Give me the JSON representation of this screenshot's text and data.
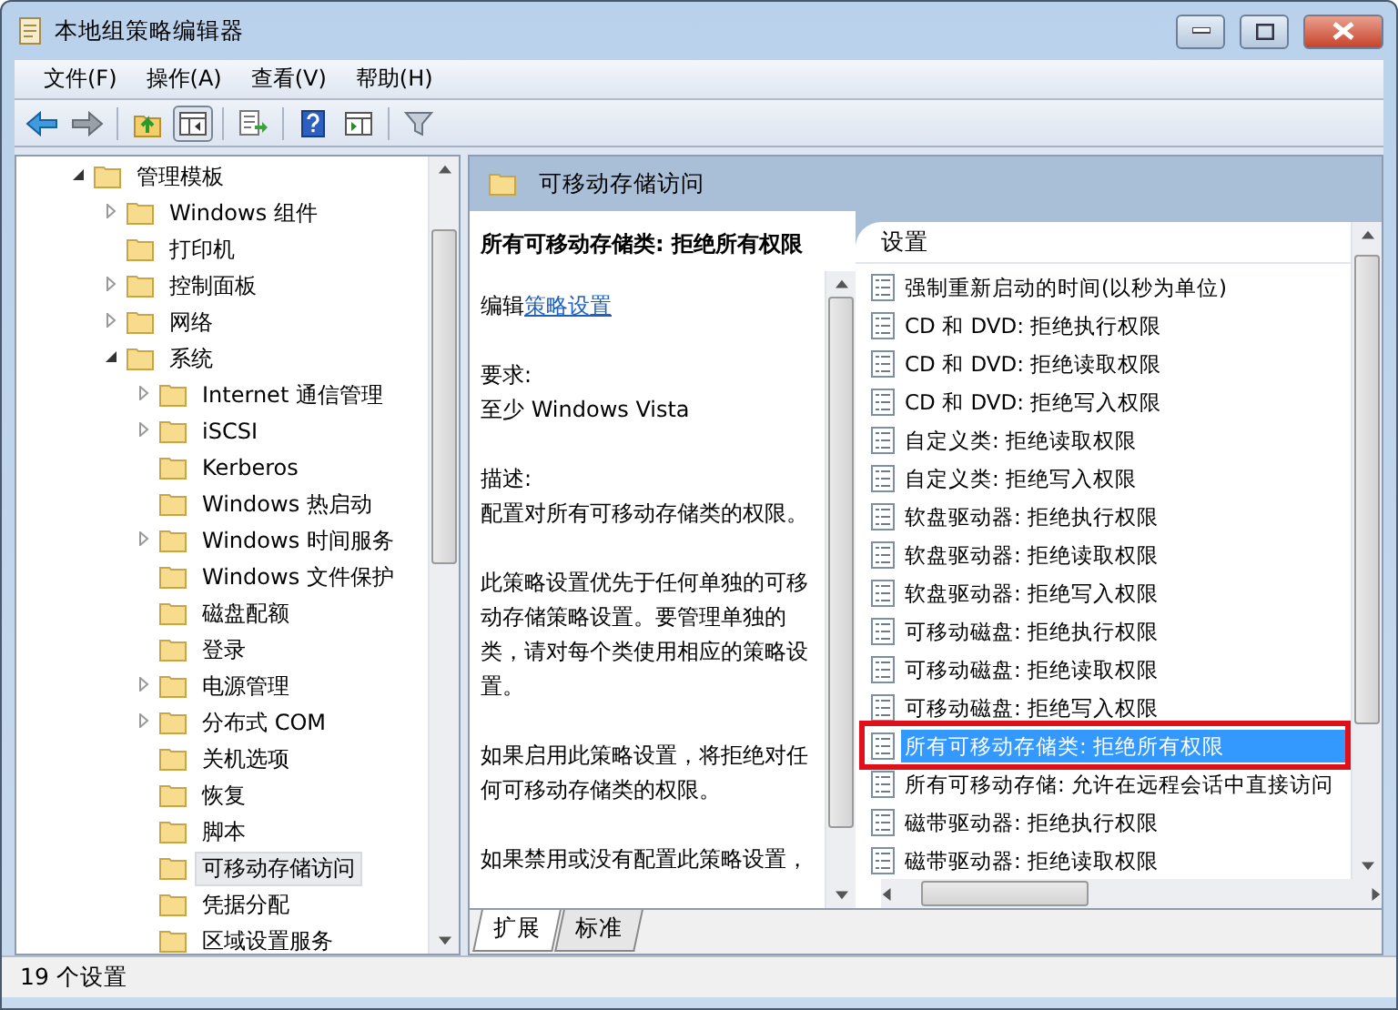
{
  "window": {
    "title": "本地组策略编辑器"
  },
  "menu": [
    {
      "label": "文件(F)"
    },
    {
      "label": "操作(A)"
    },
    {
      "label": "查看(V)"
    },
    {
      "label": "帮助(H)"
    }
  ],
  "toolbar_groups": [
    [
      {
        "kind": "back",
        "pressed": false
      },
      {
        "kind": "forward",
        "pressed": false
      }
    ],
    [
      {
        "kind": "up",
        "pressed": false
      },
      {
        "kind": "tree",
        "pressed": true
      }
    ],
    [
      {
        "kind": "export",
        "pressed": false
      }
    ],
    [
      {
        "kind": "help",
        "pressed": false
      },
      {
        "kind": "view",
        "pressed": false
      }
    ],
    [
      {
        "kind": "filter",
        "pressed": false
      }
    ]
  ],
  "tree": [
    {
      "label": "管理模板",
      "expanded": true,
      "selected": false,
      "children": [
        {
          "label": "Windows 组件",
          "expanded": false,
          "selected": false
        },
        {
          "label": "打印机",
          "selected": false
        },
        {
          "label": "控制面板",
          "expanded": false,
          "selected": false
        },
        {
          "label": "网络",
          "expanded": false,
          "selected": false
        },
        {
          "label": "系统",
          "expanded": true,
          "selected": false,
          "children": [
            {
              "label": "Internet 通信管理",
              "expanded": false,
              "selected": false
            },
            {
              "label": "iSCSI",
              "expanded": false,
              "selected": false
            },
            {
              "label": "Kerberos",
              "selected": false
            },
            {
              "label": "Windows 热启动",
              "selected": false
            },
            {
              "label": "Windows 时间服务",
              "expanded": false,
              "selected": false
            },
            {
              "label": "Windows 文件保护",
              "selected": false
            },
            {
              "label": "磁盘配额",
              "selected": false
            },
            {
              "label": "登录",
              "selected": false
            },
            {
              "label": "电源管理",
              "expanded": false,
              "selected": false
            },
            {
              "label": "分布式 COM",
              "expanded": false,
              "selected": false
            },
            {
              "label": "关机选项",
              "selected": false
            },
            {
              "label": "恢复",
              "selected": false
            },
            {
              "label": "脚本",
              "selected": false
            },
            {
              "label": "可移动存储访问",
              "selected": true
            },
            {
              "label": "凭据分配",
              "selected": false
            },
            {
              "label": "区域设置服务",
              "selected": false
            }
          ]
        }
      ]
    }
  ],
  "detail": {
    "header": "可移动存储访问",
    "policy_title": "所有可移动存储类: 拒绝所有权限",
    "edit_prefix": "编辑",
    "edit_link": "策略设置",
    "requirement_label": "要求:",
    "requirement": "至少 Windows Vista",
    "description_label": "描述:",
    "paragraphs": [
      "配置对所有可移动存储类的权限。",
      "此策略设置优先于任何单独的可移动存储策略设置。要管理单独的类，请对每个类使用相应的策略设置。",
      "如果启用此策略设置，将拒绝对任何可移动存储类的权限。",
      "如果禁用或没有配置此策略设置，"
    ]
  },
  "settings": {
    "column": "设置",
    "rows": [
      {
        "label": "强制重新启动的时间(以秒为单位)",
        "selected": false
      },
      {
        "label": "CD 和 DVD: 拒绝执行权限",
        "selected": false
      },
      {
        "label": "CD 和 DVD: 拒绝读取权限",
        "selected": false
      },
      {
        "label": "CD 和 DVD: 拒绝写入权限",
        "selected": false
      },
      {
        "label": "自定义类: 拒绝读取权限",
        "selected": false
      },
      {
        "label": "自定义类: 拒绝写入权限",
        "selected": false
      },
      {
        "label": "软盘驱动器: 拒绝执行权限",
        "selected": false
      },
      {
        "label": "软盘驱动器: 拒绝读取权限",
        "selected": false
      },
      {
        "label": "软盘驱动器: 拒绝写入权限",
        "selected": false
      },
      {
        "label": "可移动磁盘: 拒绝执行权限",
        "selected": false
      },
      {
        "label": "可移动磁盘: 拒绝读取权限",
        "selected": false
      },
      {
        "label": "可移动磁盘: 拒绝写入权限",
        "selected": false
      },
      {
        "label": "所有可移动存储类: 拒绝所有权限",
        "selected": true
      },
      {
        "label": "所有可移动存储: 允许在远程会话中直接访问",
        "selected": false
      },
      {
        "label": "磁带驱动器: 拒绝执行权限",
        "selected": false
      },
      {
        "label": "磁带驱动器: 拒绝读取权限",
        "selected": false
      }
    ]
  },
  "view_tabs": [
    {
      "label": "扩展",
      "selected": true
    },
    {
      "label": "标准",
      "selected": false
    }
  ],
  "status_bar": "19 个设置"
}
